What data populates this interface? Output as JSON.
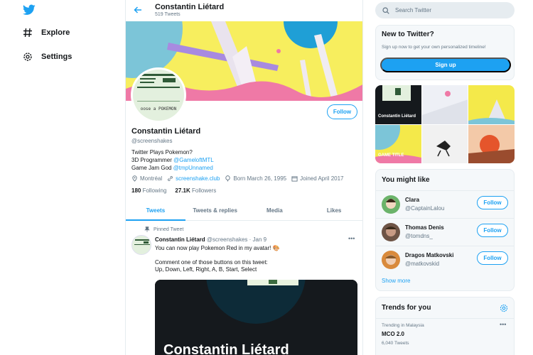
{
  "nav": {
    "explore_label": "Explore",
    "settings_label": "Settings"
  },
  "profile": {
    "top_name": "Constantin Liétard",
    "tweet_count": "519 Tweets",
    "avatar_caption": "oose a POKEMON",
    "follow_label": "Follow",
    "name": "Constantin Liétard",
    "handle": "@screenshakes",
    "bio_line1": "Twitter Plays Pokemon?",
    "bio_line2_prefix": "3D Programmer ",
    "bio_line2_link": "@GameloftMTL",
    "bio_line3_prefix": "Game Jam God ",
    "bio_line3_link": "@tmpUnnamed",
    "location": "Montréal",
    "website": "screenshake.club",
    "born": "Born March 26, 1995",
    "joined": "Joined April 2017",
    "following_count": "180",
    "following_label": "Following",
    "followers_count": "27.1K",
    "followers_label": "Followers"
  },
  "tabs": [
    "Tweets",
    "Tweets & replies",
    "Media",
    "Likes"
  ],
  "tweet": {
    "pinned_label": "Pinned Tweet",
    "author": "Constantin Liétard",
    "handle_date": "@screenshakes · Jan 9",
    "line1": "You can now play Pokemon Red in my avatar! 🎨",
    "line2": "Comment one of those buttons on this tweet:",
    "line3": "Up, Down, Left, Right, A, B, Start, Select",
    "media_text": "Constantin Liétard"
  },
  "search": {
    "placeholder": "Search Twitter"
  },
  "new_to_twitter": {
    "title": "New to Twitter?",
    "subtitle": "Sign up now to get your own personalized timeline!",
    "signup_label": "Sign up"
  },
  "media_grid": {
    "label1": "Constantin Liétard",
    "label4": "GAME TITLE"
  },
  "you_might_like": {
    "title": "You might like",
    "people": [
      {
        "name": "Clara",
        "handle": "@CaptainLalou",
        "follow": "Follow"
      },
      {
        "name": "Thomas Denis",
        "handle": "@tomdns_",
        "follow": "Follow"
      },
      {
        "name": "Dragos Matkovski",
        "handle": "@matkovskid",
        "follow": "Follow"
      }
    ],
    "show_more": "Show more"
  },
  "trends": {
    "title": "Trends for you",
    "items": [
      {
        "context": "Trending in Malaysia",
        "name": "MCO 2.0",
        "count": "6,040 Tweets"
      }
    ]
  },
  "colors": {
    "accent": "#1da1f2",
    "text": "#14171a",
    "muted": "#657786"
  }
}
